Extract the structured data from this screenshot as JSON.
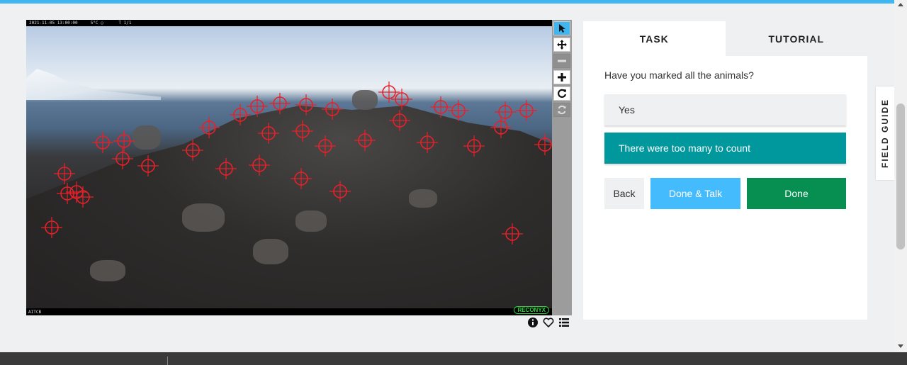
{
  "image": {
    "timestamp": "2021-11-05 13:00:00     5°C ◯      T 1/1",
    "camera": "AITCB",
    "brand": "RECONYX"
  },
  "toolbar": {
    "tools": [
      {
        "name": "pointer-tool",
        "icon": "pointer-icon",
        "state": "active"
      },
      {
        "name": "move-tool",
        "icon": "move-icon",
        "state": "normal"
      },
      {
        "name": "zoom-out-tool",
        "icon": "minus-icon",
        "state": "disabled"
      },
      {
        "name": "zoom-in-tool",
        "icon": "plus-icon",
        "state": "normal"
      },
      {
        "name": "rotate-tool",
        "icon": "rotate-icon",
        "state": "normal"
      },
      {
        "name": "reset-tool",
        "icon": "reset-icon",
        "state": "disabled"
      }
    ]
  },
  "meta_icons": [
    "info-icon",
    "heart-icon",
    "list-icon"
  ],
  "tabs": {
    "task": "TASK",
    "tutorial": "TUTORIAL"
  },
  "task": {
    "question": "Have you marked all the animals?",
    "answers": {
      "yes": "Yes",
      "many": "There were too many to count"
    },
    "buttons": {
      "back": "Back",
      "done_talk": "Done & Talk",
      "done": "Done"
    }
  },
  "field_guide": "FIELD GUIDE",
  "colors": {
    "accent_blue": "#3fb6f0",
    "teal": "#00979d",
    "green": "#078f52",
    "light_blue": "#43bbfd",
    "marker_red": "#e8202a"
  }
}
